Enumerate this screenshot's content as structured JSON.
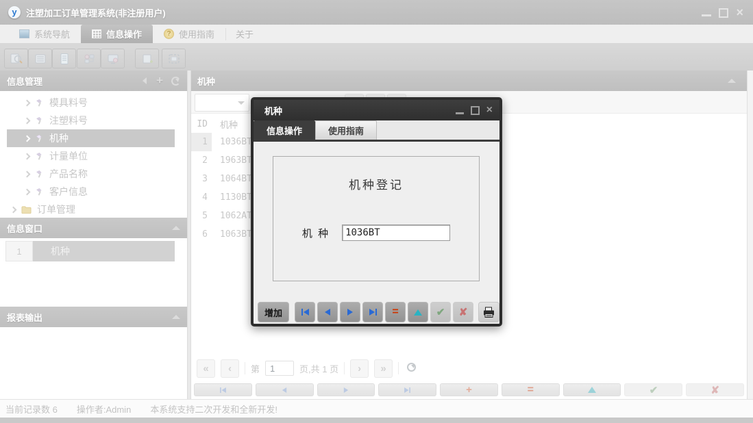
{
  "window": {
    "title": "注塑加工订单管理系统(非注册用户)",
    "app_icon_letter": "y"
  },
  "ribbon": {
    "tabs": [
      {
        "label": "系统导航"
      },
      {
        "label": "信息操作"
      },
      {
        "label": "使用指南"
      },
      {
        "label": "关于"
      }
    ]
  },
  "toolbar": {
    "icons": [
      "search-document",
      "list-view",
      "document",
      "org-chart",
      "monitor",
      "new-document",
      "frame-select"
    ]
  },
  "sidebar": {
    "info_mgmt_title": "信息管理",
    "header_icons": [
      "collapse-left",
      "add",
      "refresh"
    ],
    "tree": [
      {
        "label": "模具料号"
      },
      {
        "label": "注塑料号"
      },
      {
        "label": "机种"
      },
      {
        "label": "计量单位"
      },
      {
        "label": "产品名称"
      },
      {
        "label": "客户信息"
      },
      {
        "label": "订单管理"
      }
    ],
    "info_window_title": "信息窗口",
    "info_window_rows": [
      {
        "num": "1",
        "label": "机种"
      }
    ],
    "report_output_title": "报表输出"
  },
  "main": {
    "panel_title": "机种",
    "table": {
      "col_id": "ID",
      "col_machine": "机种",
      "rows": [
        {
          "id": "1",
          "machine": "1036BT"
        },
        {
          "id": "2",
          "machine": "1963BT"
        },
        {
          "id": "3",
          "machine": "1064BT"
        },
        {
          "id": "4",
          "machine": "1130BT"
        },
        {
          "id": "5",
          "machine": "1062AT"
        },
        {
          "id": "6",
          "machine": "1063BT"
        }
      ]
    },
    "pager": {
      "first": "«",
      "prev": "‹",
      "label_page": "第",
      "page_value": "1",
      "label_total": "页,共 1 页",
      "next": "›",
      "last": "»"
    }
  },
  "dialog": {
    "title": "机种",
    "tabs": [
      {
        "label": "信息操作"
      },
      {
        "label": "使用指南"
      }
    ],
    "group_title": "机种登记",
    "field_label": "机 种",
    "field_value": "1036BT",
    "add_button_label": "增加",
    "nav_icons": [
      "first-record",
      "prev-record",
      "next-record",
      "last-record",
      "delete-record",
      "edit-record",
      "confirm",
      "cancel",
      "print"
    ]
  },
  "statusbar": {
    "records": "当前记录数 6",
    "operator": "操作者:Admin",
    "note": "本系统支持二次开发和全新开发!"
  },
  "colors": {
    "accent_blue": "#2a6ad4",
    "accent_red": "#cf3400",
    "accent_teal": "#2ab3c3",
    "dialog_dark": "#2d2d2d"
  }
}
